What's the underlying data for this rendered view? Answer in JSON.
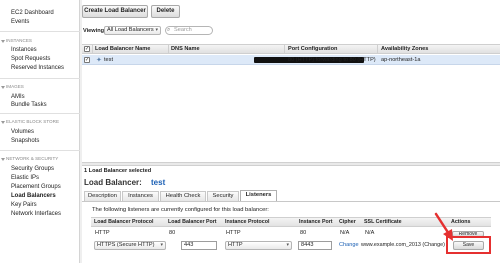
{
  "sidebar": {
    "top_items": [
      "EC2 Dashboard",
      "Events"
    ],
    "sections": [
      {
        "title": "INSTANCES",
        "items": [
          "Instances",
          "Spot Requests",
          "Reserved Instances"
        ]
      },
      {
        "title": "IMAGES",
        "items": [
          "AMIs",
          "Bundle Tasks"
        ]
      },
      {
        "title": "ELASTIC BLOCK STORE",
        "items": [
          "Volumes",
          "Snapshots"
        ]
      },
      {
        "title": "NETWORK & SECURITY",
        "items": [
          "Security Groups",
          "Elastic IPs",
          "Placement Groups",
          "Load Balancers",
          "Key Pairs",
          "Network Interfaces"
        ]
      }
    ],
    "active_item": "Load Balancers"
  },
  "toolbar": {
    "create_label": "Create Load Balancer",
    "delete_label": "Delete",
    "viewing_label": "Viewing:",
    "viewing_value": "All Load Balancers",
    "search_placeholder": "Search"
  },
  "table": {
    "columns": [
      "Load Balancer Name",
      "DNS Name",
      "Port Configuration",
      "Availability Zones"
    ],
    "rows": [
      {
        "name": "test",
        "dns": "",
        "port_config": "80 (HTTP) forwarding to 80 (HTTP)",
        "zones": "ap-northeast-1a",
        "checked": true
      }
    ]
  },
  "detail": {
    "selected_count": "1 Load Balancer selected",
    "title_label": "Load Balancer:",
    "title_value": "test",
    "tabs": [
      "Description",
      "Instances",
      "Health Check",
      "Security",
      "Listeners"
    ],
    "active_tab": "Listeners",
    "listeners_intro": "The following listeners are currently configured for this load balancer:",
    "listener_columns": [
      "Load Balancer Protocol",
      "Load Balancer Port",
      "Instance Protocol",
      "Instance Port",
      "Cipher",
      "SSL Certificate",
      "Actions"
    ],
    "existing_listener": {
      "lb_protocol": "HTTP",
      "lb_port": "80",
      "instance_protocol": "HTTP",
      "instance_port": "80",
      "cipher": "N/A",
      "ssl_cert": "N/A",
      "action": "Remove"
    },
    "new_listener": {
      "lb_protocol": "HTTPS (Secure HTTP)",
      "lb_port": "443",
      "instance_protocol": "HTTP",
      "instance_port": "8443",
      "cipher_action": "Change",
      "ssl_cert": "www.example.com_2013 (Change)",
      "action": "Save"
    }
  },
  "colors": {
    "selected_row": "#dde9f8",
    "highlight": "#e53030",
    "link": "#1a5fb4"
  },
  "icons": {
    "row_icon": "load-balancer-icon",
    "search": "search-icon",
    "annotation": "red-arrow-icon"
  }
}
